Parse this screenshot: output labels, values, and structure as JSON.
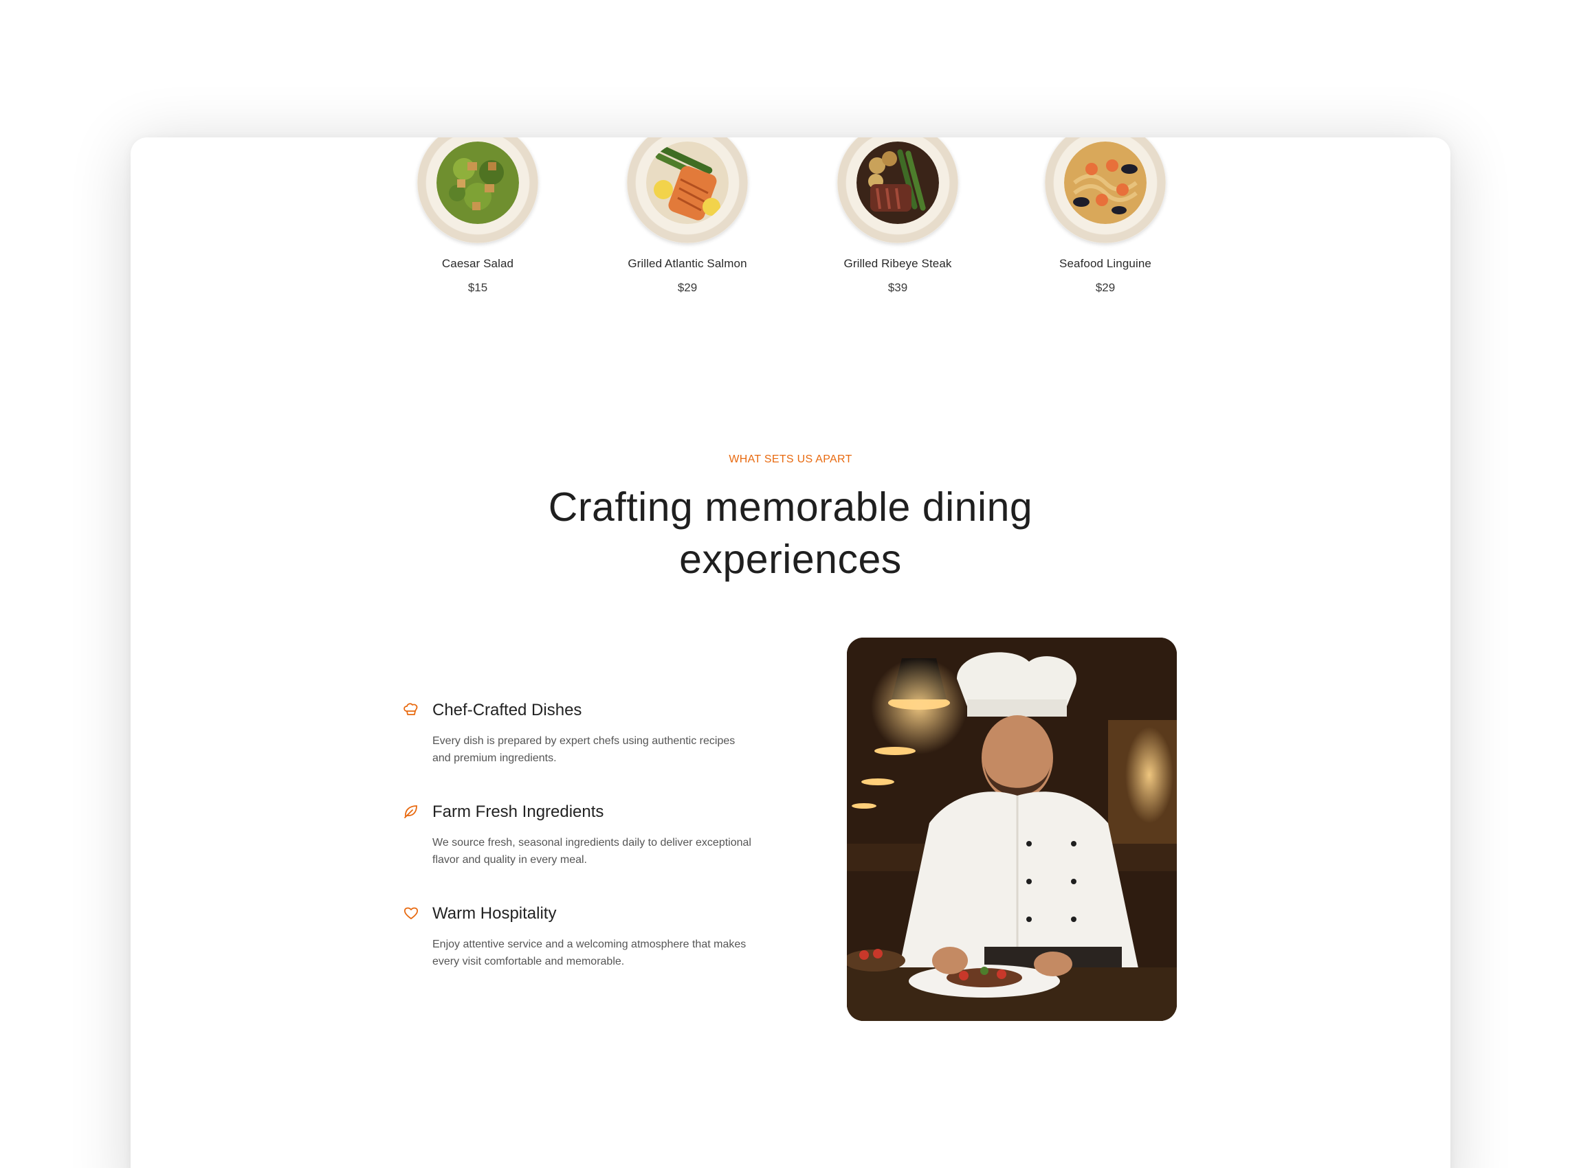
{
  "menu": {
    "dishes": [
      {
        "name": "Caesar Salad",
        "price": "$15",
        "image": "caesar-salad-plate"
      },
      {
        "name": "Grilled Atlantic Salmon",
        "price": "$29",
        "image": "salmon-plate"
      },
      {
        "name": "Grilled Ribeye Steak",
        "price": "$39",
        "image": "steak-plate"
      },
      {
        "name": "Seafood Linguine",
        "price": "$29",
        "image": "linguine-plate"
      }
    ]
  },
  "about": {
    "eyebrow": "WHAT SETS US APART",
    "headline": "Crafting memorable dining experiences",
    "features": [
      {
        "icon": "chef-hat-icon",
        "title": "Chef-Crafted Dishes",
        "description": "Every dish is prepared by expert chefs using authentic recipes and premium ingredients."
      },
      {
        "icon": "leaf-icon",
        "title": "Farm Fresh Ingredients",
        "description": "We source fresh, seasonal ingredients daily to deliver exceptional flavor and quality in every meal."
      },
      {
        "icon": "heart-icon",
        "title": "Warm Hospitality",
        "description": "Enjoy attentive service and a welcoming atmosphere that makes every visit comfortable and memorable."
      }
    ],
    "image": "chef-plating-dish-photo"
  },
  "colors": {
    "accent": "#e8690f",
    "text": "#1f1f1f",
    "muted": "#555555"
  }
}
